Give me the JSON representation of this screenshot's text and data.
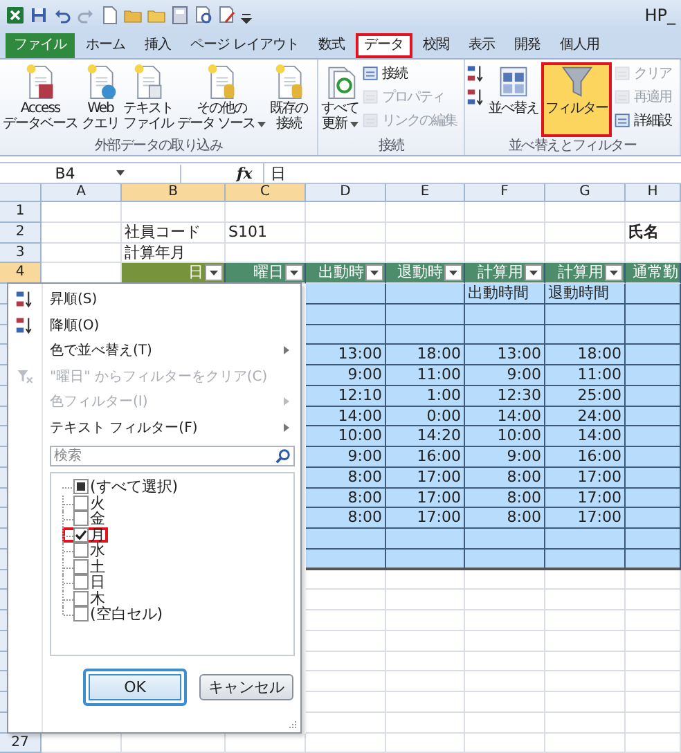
{
  "title_bar": {
    "title": "HP_"
  },
  "tabs": [
    {
      "label": "ファイル",
      "kind": "file",
      "selected": false,
      "highlighted": false
    },
    {
      "label": "ホーム",
      "kind": "tab",
      "selected": false,
      "highlighted": false
    },
    {
      "label": "挿入",
      "kind": "tab",
      "selected": false,
      "highlighted": false
    },
    {
      "label": "ページ レイアウト",
      "kind": "tab",
      "selected": false,
      "highlighted": false
    },
    {
      "label": "数式",
      "kind": "tab",
      "selected": false,
      "highlighted": false
    },
    {
      "label": "データ",
      "kind": "tab",
      "selected": true,
      "highlighted": true
    },
    {
      "label": "校閲",
      "kind": "tab",
      "selected": false,
      "highlighted": false
    },
    {
      "label": "表示",
      "kind": "tab",
      "selected": false,
      "highlighted": false
    },
    {
      "label": "開発",
      "kind": "tab",
      "selected": false,
      "highlighted": false
    },
    {
      "label": "個人用",
      "kind": "tab",
      "selected": false,
      "highlighted": false
    }
  ],
  "ribbon": {
    "groups": [
      {
        "label": "外部データの取り込み",
        "items": [
          {
            "kind": "access",
            "lines": [
              "Access",
              "データベース"
            ],
            "dropdown": false,
            "disabled": false,
            "highlighted": false
          },
          {
            "kind": "web",
            "lines": [
              "Web",
              "クエリ"
            ],
            "dropdown": false,
            "disabled": false,
            "highlighted": false
          },
          {
            "kind": "text-file",
            "lines": [
              "テキスト",
              "ファイル"
            ],
            "dropdown": false,
            "disabled": false,
            "highlighted": false
          },
          {
            "kind": "other-source",
            "lines": [
              "その他の",
              "データ ソース"
            ],
            "dropdown": true,
            "disabled": false,
            "highlighted": false
          },
          {
            "kind": "existing",
            "lines": [
              "既存の",
              "接続"
            ],
            "dropdown": false,
            "disabled": false,
            "highlighted": false
          }
        ]
      },
      {
        "label": "接続",
        "items": [
          {
            "kind": "refresh",
            "lines": [
              "すべて",
              "更新"
            ],
            "dropdown": true,
            "disabled": false,
            "highlighted": false
          },
          {
            "kind": "connections",
            "lines": [
              "接続"
            ],
            "dropdown": false,
            "disabled": false,
            "highlighted": false
          },
          {
            "kind": "properties",
            "lines": [
              "プロパティ"
            ],
            "dropdown": false,
            "disabled": true,
            "highlighted": false
          },
          {
            "kind": "edit-links",
            "lines": [
              "リンクの編集"
            ],
            "dropdown": false,
            "disabled": true,
            "highlighted": false
          }
        ]
      },
      {
        "label": "並べ替えとフィルター",
        "items": [
          {
            "kind": "sort-asc",
            "dropdown": false,
            "disabled": false,
            "highlighted": false
          },
          {
            "kind": "sort-desc",
            "dropdown": false,
            "disabled": false,
            "highlighted": false
          },
          {
            "kind": "sort",
            "lines": [
              "並べ替え"
            ],
            "dropdown": false,
            "disabled": false,
            "highlighted": false
          },
          {
            "kind": "filter",
            "lines": [
              "フィルター"
            ],
            "dropdown": false,
            "disabled": false,
            "highlighted": true
          },
          {
            "kind": "clear",
            "lines": [
              "クリア"
            ],
            "dropdown": false,
            "disabled": true,
            "highlighted": false
          },
          {
            "kind": "reapply",
            "lines": [
              "再適用"
            ],
            "dropdown": false,
            "disabled": true,
            "highlighted": false
          },
          {
            "kind": "advanced",
            "lines": [
              "詳細設"
            ],
            "dropdown": false,
            "disabled": false,
            "highlighted": false
          }
        ]
      }
    ]
  },
  "formula_bar": {
    "name_box": "B4",
    "function_label": "fx",
    "formula": "日"
  },
  "sheet": {
    "columns": [
      {
        "label": "A",
        "selected": false
      },
      {
        "label": "B",
        "selected": true
      },
      {
        "label": "C",
        "selected": true
      },
      {
        "label": "D",
        "selected": false
      },
      {
        "label": "E",
        "selected": false
      },
      {
        "label": "F",
        "selected": false
      },
      {
        "label": "G",
        "selected": false
      },
      {
        "label": "H",
        "selected": false
      }
    ],
    "rows": [
      {
        "number": "1",
        "kind": "plain",
        "selected": false,
        "cells": {}
      },
      {
        "number": "2",
        "kind": "plain",
        "selected": false,
        "cells": {
          "B": "社員コード",
          "C": "S101",
          "H": "氏名"
        }
      },
      {
        "number": "3",
        "kind": "plain",
        "selected": false,
        "cells": {
          "B": "計算年月"
        }
      },
      {
        "number": "4",
        "kind": "header",
        "selected": true,
        "cells": {
          "B": {
            "text": "日",
            "filter": true,
            "active": true
          },
          "C": {
            "text": "曜日",
            "filter": true,
            "active": false
          },
          "D": {
            "text": "出動時",
            "filter": true,
            "active": false
          },
          "E": {
            "text": "退動時",
            "filter": true,
            "active": false
          },
          "F": {
            "text": "計算用",
            "filter": true,
            "active": false
          },
          "G": {
            "text": "計算用",
            "filter": true,
            "active": false
          },
          "H": {
            "text": "通常勤",
            "filter": false,
            "active": false
          }
        }
      },
      {
        "kind": "table-label",
        "selected": false,
        "cells": {
          "F": "出動時間",
          "G": "退動時間"
        }
      },
      {
        "kind": "table",
        "selected": false,
        "cells": {}
      },
      {
        "kind": "table",
        "selected": false,
        "cells": {}
      },
      {
        "kind": "table",
        "selected": false,
        "cells": {
          "D": "13:00",
          "E": "18:00",
          "F": "13:00",
          "G": "18:00"
        }
      },
      {
        "kind": "table",
        "selected": false,
        "cells": {
          "D": "9:00",
          "E": "11:00",
          "F": "9:00",
          "G": "11:00"
        }
      },
      {
        "kind": "table",
        "selected": false,
        "cells": {
          "D": "12:10",
          "E": "1:00",
          "F": "12:30",
          "G": "25:00"
        }
      },
      {
        "kind": "table",
        "selected": false,
        "cells": {
          "D": "14:00",
          "E": "0:00",
          "F": "14:00",
          "G": "24:00"
        }
      },
      {
        "kind": "table",
        "selected": false,
        "cells": {
          "D": "10:00",
          "E": "14:20",
          "F": "10:00",
          "G": "14:00"
        }
      },
      {
        "kind": "table",
        "selected": false,
        "cells": {
          "D": "9:00",
          "E": "16:00",
          "F": "9:00",
          "G": "16:00"
        }
      },
      {
        "kind": "table",
        "selected": false,
        "cells": {
          "D": "8:00",
          "E": "17:00",
          "F": "8:00",
          "G": "17:00"
        }
      },
      {
        "kind": "table",
        "selected": false,
        "cells": {
          "D": "8:00",
          "E": "17:00",
          "F": "8:00",
          "G": "17:00"
        }
      },
      {
        "kind": "table",
        "selected": false,
        "cells": {
          "D": "8:00",
          "E": "17:00",
          "F": "8:00",
          "G": "17:00"
        }
      },
      {
        "kind": "table",
        "selected": false,
        "cells": {}
      },
      {
        "kind": "table-end",
        "selected": false,
        "cells": {}
      },
      {
        "kind": "plain",
        "selected": false,
        "cells": {}
      },
      {
        "kind": "plain",
        "selected": false,
        "cells": {}
      },
      {
        "kind": "plain",
        "selected": false,
        "cells": {}
      },
      {
        "kind": "plain",
        "selected": false,
        "cells": {}
      },
      {
        "kind": "plain",
        "selected": false,
        "cells": {}
      },
      {
        "kind": "plain",
        "selected": false,
        "cells": {}
      },
      {
        "kind": "plain",
        "selected": false,
        "cells": {}
      },
      {
        "kind": "plain",
        "selected": false,
        "cells": {}
      },
      {
        "number": "27",
        "kind": "plain",
        "selected": false,
        "cells": {}
      }
    ]
  },
  "filter_menu": {
    "commands": [
      {
        "label": "昇順(S)",
        "kind": "sort-asc",
        "disabled": false,
        "submenu": false
      },
      {
        "label": "降順(O)",
        "kind": "sort-desc",
        "disabled": false,
        "submenu": false
      },
      {
        "label": "色で並べ替え(T)",
        "kind": "plain",
        "disabled": false,
        "submenu": true
      },
      {
        "label": "\"曜日\" からフィルターをクリア(C)",
        "kind": "clear-filter",
        "disabled": true,
        "submenu": false
      },
      {
        "label": "色フィルター(I)",
        "kind": "plain",
        "disabled": true,
        "submenu": true
      },
      {
        "label": "テキスト フィルター(F)",
        "kind": "plain",
        "disabled": false,
        "submenu": true
      }
    ],
    "search": {
      "placeholder": "検索"
    },
    "values": [
      {
        "label": "(すべて選択)",
        "checked": false,
        "partial": true,
        "highlighted": false
      },
      {
        "label": "火",
        "checked": false,
        "partial": false,
        "highlighted": false
      },
      {
        "label": "金",
        "checked": false,
        "partial": false,
        "highlighted": false
      },
      {
        "label": "月",
        "checked": true,
        "partial": false,
        "highlighted": true
      },
      {
        "label": "水",
        "checked": false,
        "partial": false,
        "highlighted": false
      },
      {
        "label": "土",
        "checked": false,
        "partial": false,
        "highlighted": false
      },
      {
        "label": "日",
        "checked": false,
        "partial": false,
        "highlighted": false
      },
      {
        "label": "木",
        "checked": false,
        "partial": false,
        "highlighted": false
      },
      {
        "label": "(空白セル)",
        "checked": false,
        "partial": false,
        "highlighted": false
      }
    ],
    "buttons": [
      {
        "label": "OK",
        "default": true,
        "highlighted": true
      },
      {
        "label": "キャンセル",
        "default": false,
        "highlighted": false
      }
    ]
  }
}
